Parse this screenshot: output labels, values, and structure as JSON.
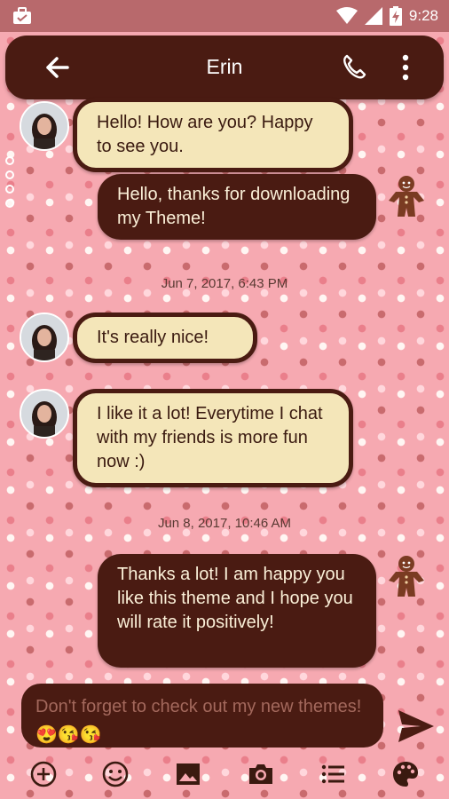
{
  "status_bar": {
    "time": "9:28",
    "icons": [
      "briefcase-icon",
      "wifi-icon",
      "signal-icon",
      "battery-charging-icon"
    ]
  },
  "header": {
    "contact_name": "Erin",
    "icons": [
      "back-arrow-icon",
      "phone-icon",
      "more-vert-icon"
    ]
  },
  "messages": [
    {
      "direction": "incoming",
      "text": "Hello! How are you? Happy to see you."
    },
    {
      "direction": "outgoing",
      "text": "Hello, thanks for downloading my Theme!"
    },
    {
      "direction": "incoming",
      "text": "It's really nice!"
    },
    {
      "direction": "incoming",
      "text": "I like it a lot! Everytime I chat with my friends is more fun now :)"
    },
    {
      "direction": "outgoing",
      "text": "Thanks a lot! I am happy you like this theme and I hope you will rate it positively!"
    }
  ],
  "timestamps": [
    "Jun 7, 2017, 6:43 PM",
    "Jun 8, 2017, 10:46 AM"
  ],
  "compose": {
    "text": "Don't forget to check out my new themes!",
    "emojis": "😍😘😘"
  },
  "toolbar": {
    "icons": [
      "add-circle-icon",
      "emoji-icon",
      "image-icon",
      "camera-icon",
      "list-icon",
      "palette-icon"
    ]
  },
  "colors": {
    "background_pink": "#f6a9b1",
    "dark_brown": "#4a1b12",
    "cream": "#f4e6b9",
    "status_bar": "#b8696c"
  }
}
